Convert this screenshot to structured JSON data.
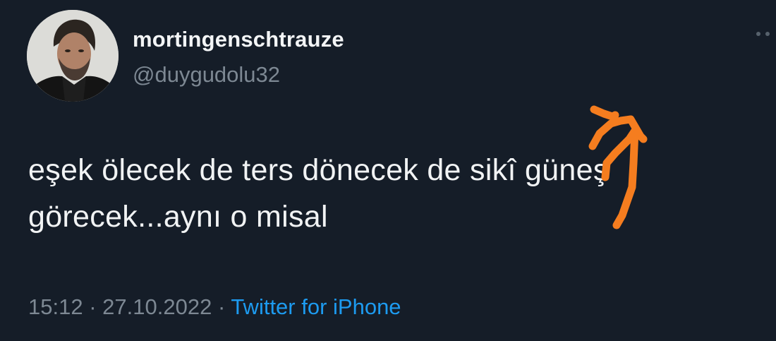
{
  "tweet": {
    "display_name": "mortingenschtrauze",
    "handle": "@duygudolu32",
    "text_line1": "eşek ölecek de ters dönecek de sikî güneş",
    "text_line2": "görecek...aynı o misal",
    "time": "15:12",
    "separator": "·",
    "date": "27.10.2022",
    "source": "Twitter for iPhone"
  },
  "icons": {
    "more": "more-options-icon",
    "avatar": "profile-avatar"
  },
  "colors": {
    "background": "#151d28",
    "primary_text": "#f1f3f4",
    "secondary_text": "#7d8893",
    "link": "#1d9bf0",
    "annotation": "#f57d1f"
  }
}
